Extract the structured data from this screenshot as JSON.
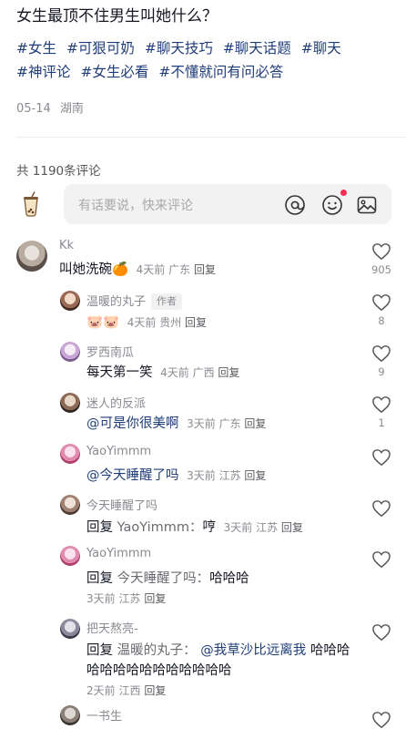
{
  "post": {
    "title": "女生最顶不住男生叫她什么？",
    "tags": [
      "#女生",
      "#可狠可奶",
      "#聊天技巧",
      "#聊天话题",
      "#聊天",
      "#神评论",
      "#女生必看",
      "#不懂就问有问必答"
    ],
    "date": "05-14",
    "location": "湖南"
  },
  "comments_header": {
    "count_label": "共 1190条评论"
  },
  "input": {
    "placeholder": "有话要说，快来评论"
  },
  "icons": {
    "emoji_notice_color": "#fe2c55",
    "tag_color": "#1f3d7a"
  },
  "comments": [
    {
      "user": "Kk",
      "text": "叫她洗碗",
      "emoji": "🍊",
      "time": "4天前",
      "region": "广东",
      "reply": "回复",
      "likes": "905"
    },
    {
      "user": "温暖的丸子",
      "author_tag": "作者",
      "emoji": "🐷🐷",
      "time": "4天前",
      "region": "贵州",
      "reply": "回复",
      "likes": "8"
    },
    {
      "user": "罗西南瓜",
      "text": "每天第一笑",
      "time": "4天前",
      "region": "广西",
      "reply": "回复",
      "likes": "9"
    },
    {
      "user": "迷人的反派",
      "mention": "@可是你很美啊",
      "time": "3天前",
      "region": "广东",
      "reply": "回复",
      "likes": "1"
    },
    {
      "user": "YaoYimmm",
      "mention": "@今天睡醒了吗",
      "time": "3天前",
      "region": "江苏",
      "reply": "回复",
      "likes": ""
    },
    {
      "user": "今天睡醒了吗",
      "reply_kw": "回复",
      "reply_to": "YaoYimmm：",
      "text": "哼",
      "time": "3天前",
      "region": "江苏",
      "reply": "回复",
      "likes": ""
    },
    {
      "user": "YaoYimmm",
      "reply_kw": "回复",
      "reply_to": "今天睡醒了吗：",
      "text": "哈哈哈",
      "time": "3天前",
      "region": "江苏",
      "reply": "回复",
      "likes": ""
    },
    {
      "user": "把天熬亮-",
      "reply_kw": "回复",
      "reply_to": "温暖的丸子：",
      "mention": "@我草沙比远离我",
      "text": "哈哈哈哈哈哈哈哈哈哈哈哈哈哈",
      "time": "2天前",
      "region": "江西",
      "reply": "回复",
      "likes": ""
    },
    {
      "user": "一书生",
      "likes": ""
    }
  ]
}
